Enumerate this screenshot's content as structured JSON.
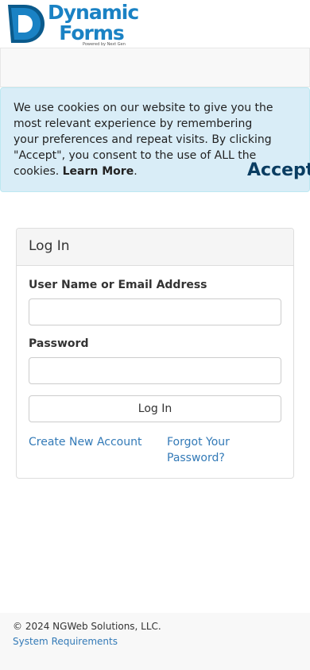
{
  "brand": {
    "line1": "Dynamic",
    "line2": "Forms",
    "tagline": "Powered by Next Gen",
    "primary_color": "#1a82c4",
    "dark_color": "#0a5a8c"
  },
  "cookie_banner": {
    "message": "We use cookies on our website to give you the most relevant experience by remembering your preferences and repeat visits. By clicking \"Accept\", you consent to the use of ALL the cookies.",
    "learn_more": "Learn More",
    "period": ".",
    "accept_label": "Accept",
    "background": "#d9edf7"
  },
  "login": {
    "heading": "Log In",
    "username_label": "User Name or Email Address",
    "username_value": "",
    "password_label": "Password",
    "password_value": "",
    "submit_label": "Log In",
    "create_account": "Create New Account",
    "forgot_password_line1": "Forgot Your",
    "forgot_password_line2": "Password?"
  },
  "footer": {
    "copyright": "© 2024 NGWeb Solutions, LLC.",
    "system_requirements": "System Requirements",
    "link_color": "#337ab7"
  }
}
